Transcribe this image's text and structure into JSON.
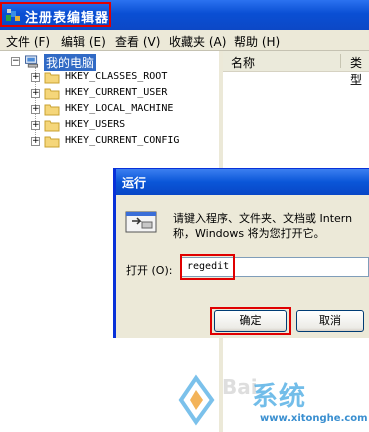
{
  "window": {
    "title": "注册表编辑器",
    "app_icon": "registry-editor-icon"
  },
  "menu": [
    {
      "label": "文件 (F)"
    },
    {
      "label": "编辑 (E)"
    },
    {
      "label": "查看 (V)"
    },
    {
      "label": "收藏夹 (A)"
    },
    {
      "label": "帮助 (H)"
    }
  ],
  "tree": {
    "root": "我的电脑",
    "keys": [
      "HKEY_CLASSES_ROOT",
      "HKEY_CURRENT_USER",
      "HKEY_LOCAL_MACHINE",
      "HKEY_USERS",
      "HKEY_CURRENT_CONFIG"
    ]
  },
  "list": {
    "columns": [
      "名称",
      "类型"
    ]
  },
  "run_dialog": {
    "title": "运行",
    "description_line1": "请键入程序、文件夹、文档或 Intern",
    "description_line2": "称，Windows 将为您打开它。",
    "open_label": "打开 (O):",
    "input_value": "regedit",
    "ok_label": "确定",
    "cancel_label": "取消"
  },
  "watermark": {
    "brand": "系统",
    "url": "www.xitonghe.com",
    "baidu": "Bai"
  },
  "colors": {
    "title_bar": "#0a4fd4",
    "highlight_box": "#e00000",
    "selection": "#316ac5"
  }
}
